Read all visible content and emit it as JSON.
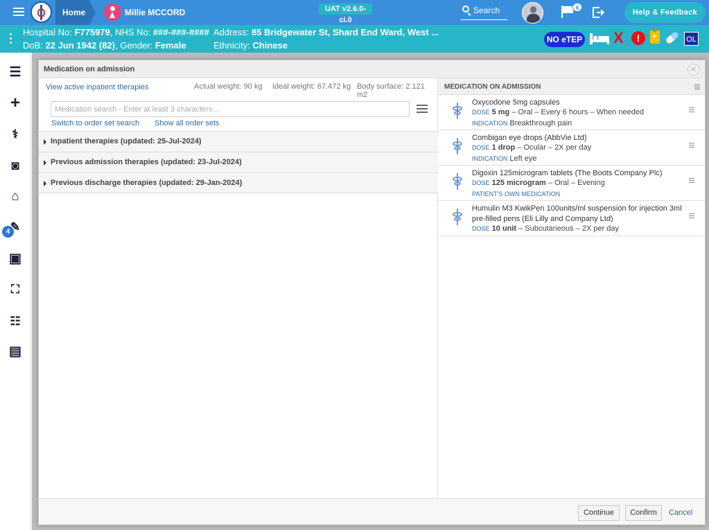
{
  "topbar": {
    "home_label": "Home",
    "patient_name": "Millie MCCORD",
    "env_badge": "UAT v2.6.0-ci.0",
    "search_label": "Search",
    "notification_count": "6",
    "help_label": "Help & Feedback",
    "colors": {
      "bar": "#3a8fdc",
      "accent": "#27b5c9"
    }
  },
  "patient_banner": {
    "hospital_no_label": "Hospital No:",
    "hospital_no": "F775979",
    "nhs_no_label": "NHS No:",
    "nhs_no": "###-###-####",
    "address_label": "Address:",
    "address": "85 Bridgewater St, Shard End Ward, West ...",
    "dob_label": "DoB:",
    "dob": "22 Jun 1942 (82)",
    "gender_label": "Gender:",
    "gender": "Female",
    "ethnicity_label": "Ethnicity:",
    "ethnicity": "Chinese",
    "no_etep_label": "NO eTEP",
    "x_label": "X",
    "alert_label": "!",
    "ol_label": "OL"
  },
  "sidebar": {
    "icons": [
      "list-icon",
      "plus-icon",
      "stethoscope-icon",
      "camera-icon",
      "home-medical-icon",
      "prescription-edit-icon",
      "medical-case-icon",
      "home-walk-icon",
      "checklist-icon",
      "ward-board-icon"
    ],
    "badge_count": "4"
  },
  "modal": {
    "title": "Medication on admission",
    "view_active_link": "View active inpatient therapies",
    "actual_weight": "Actual weight: 90 kg",
    "ideal_weight": "Ideal weight: 67.472 kg",
    "body_surface": "Body surface: 2.121 m2",
    "search_placeholder": "Medication search - Enter at least 3 characters...",
    "switch_order_set": "Switch to order set search",
    "show_all_order_sets": "Show all order sets",
    "groups": [
      {
        "label": "Inpatient therapies (updated: 25-Jul-2024)"
      },
      {
        "label": "Previous admission therapies (updated: 23-Jul-2024)"
      },
      {
        "label": "Previous discharge therapies (updated: 29-Jan-2024)"
      }
    ],
    "right_title": "MEDICATION ON ADMISSION",
    "dose_caption": "DOSE",
    "indication_caption": "INDICATION",
    "medications": [
      {
        "name": "Oxycodone 5mg capsules",
        "dose": "5 mg",
        "detail": "– Oral – Every 6 hours – When needed",
        "indication": "Breakthrough pain"
      },
      {
        "name": "Combigan eye drops (AbbVie Ltd)",
        "dose": "1 drop",
        "detail": "– Ocular – 2X per day",
        "indication": "Left eye"
      },
      {
        "name": "Digoxin 125microgram tablets (The Boots Company Plc)",
        "dose": "125 microgram",
        "detail": "– Oral – Evening",
        "note": "PATIENT'S OWN MEDICATION"
      },
      {
        "name": "Humulin M3 KwikPen 100units/ml suspension for injection 3ml pre-filled pens (Eli Lilly and Company Ltd)",
        "dose": "10 unit",
        "detail": "– Subcutaneous – 2X per day"
      }
    ],
    "continue_label": "Continue",
    "confirm_label": "Confirm",
    "cancel_label": "Cancel"
  }
}
